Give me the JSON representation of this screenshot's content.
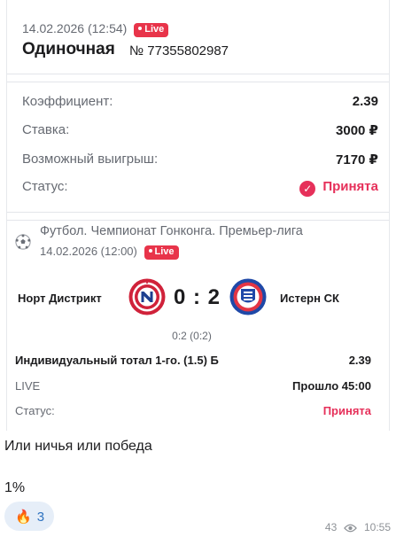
{
  "header": {
    "datetime": "14.02.2026 (12:54)",
    "live_label": "Live",
    "bet_type": "Одиночная",
    "bet_number": "№ 77355802987"
  },
  "summary": {
    "rows": [
      {
        "label": "Коэффициент:",
        "value": "2.39"
      },
      {
        "label": "Ставка:",
        "value": "3000 ₽"
      },
      {
        "label": "Возможный выигрыш:",
        "value": "7170 ₽"
      }
    ],
    "status_label": "Статус:",
    "status_value": "Принята",
    "status_icon": "check-circle-icon",
    "status_color": "#e6305a"
  },
  "match": {
    "league": "Футбол. Чемпионат Гонконга. Премьер-лига",
    "date": "14.02.2026 (12:00)",
    "live_label": "Live",
    "sport_icon": "soccer-ball-icon",
    "home_team": "Норт Дистрикт",
    "away_team": "Истерн СК",
    "score": "0 : 2",
    "half_score": "0:2 (0:2)",
    "market": "Индивидуальный тотал 1-го. (1.5) Б",
    "market_odds": "2.39",
    "stage_label": "LIVE",
    "elapsed": "Прошло 45:00",
    "status_label": "Статус:",
    "status_value": "Принята"
  },
  "messages": {
    "text1": "Или ничья или победа",
    "text2": "1%",
    "reaction_emoji": "🔥",
    "reaction_count": "3",
    "views": "43",
    "time": "10:55"
  },
  "colors": {
    "accent": "#e6305a",
    "live": "#e8344a",
    "muted": "#666a72"
  }
}
